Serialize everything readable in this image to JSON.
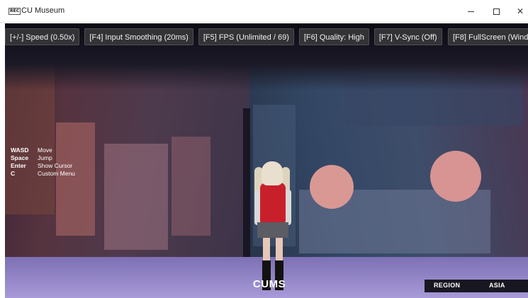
{
  "window": {
    "app_icon_text": "REC",
    "title": "CU Museum"
  },
  "toolbar": {
    "buttons": [
      "[+/-] Speed (0.50x)",
      "[F4] Input Smoothing (20ms)",
      "[F5] FPS (Unlimited / 69)",
      "[F6] Quality: High",
      "[F7] V-Sync (Off)",
      "[F8] FullScreen (Wind"
    ]
  },
  "controls": [
    {
      "key": "WASD",
      "action": "Move"
    },
    {
      "key": "Space",
      "action": "Jump"
    },
    {
      "key": "Enter",
      "action": "Show Cursor"
    },
    {
      "key": "C",
      "action": "Custom Menu"
    }
  ],
  "hud": {
    "location": "CUMS",
    "region_label": "REGION",
    "region_value": "ASIA"
  },
  "icons": {
    "minimize": "minimize-icon",
    "maximize": "maximize-icon",
    "close": "close-icon"
  }
}
